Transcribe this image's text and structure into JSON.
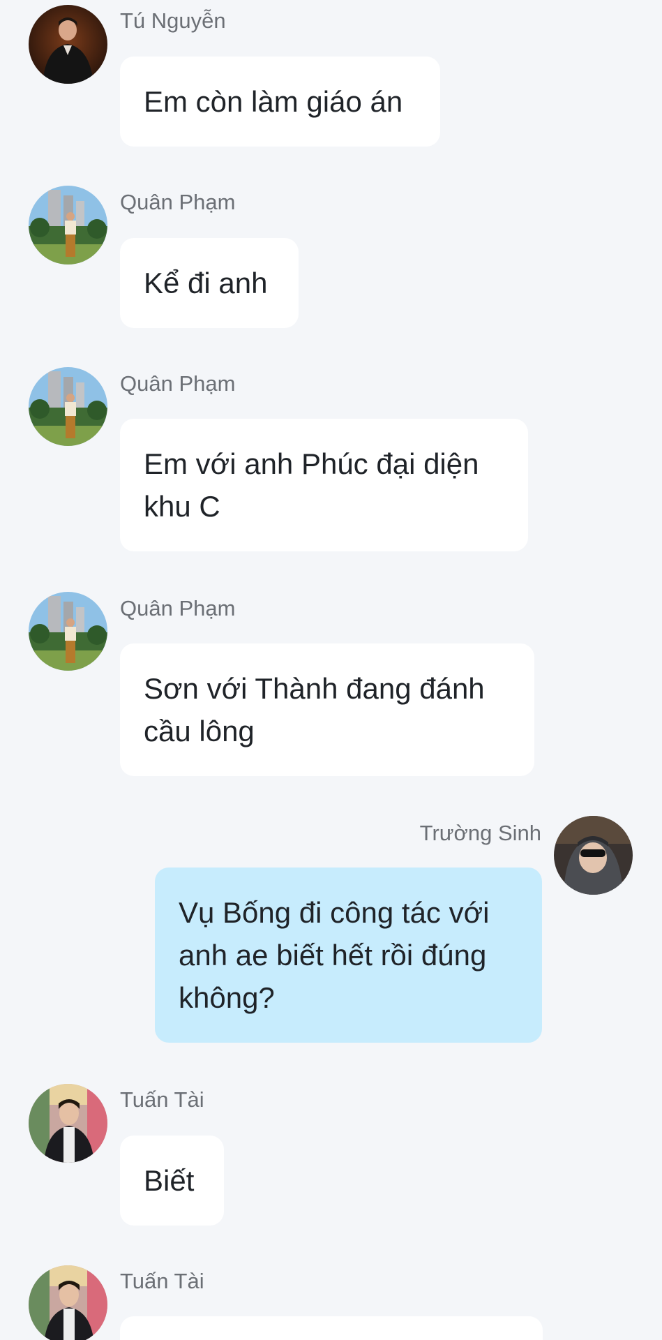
{
  "colors": {
    "background": "#f4f6f9",
    "incoming_bubble": "#ffffff",
    "outgoing_bubble": "#c7ecfd",
    "sender_text": "#6b6f75",
    "message_text": "#1f2328"
  },
  "messages": [
    {
      "sender": "Tú Nguyễn",
      "text": "Em còn làm giáo án",
      "direction": "incoming",
      "avatar": "tu-nguyen-avatar"
    },
    {
      "sender": "Quân Phạm",
      "text": "Kể đi anh",
      "direction": "incoming",
      "avatar": "quan-pham-avatar"
    },
    {
      "sender": "Quân Phạm",
      "text": "Em với anh Phúc đại diện\nkhu C",
      "direction": "incoming",
      "avatar": "quan-pham-avatar"
    },
    {
      "sender": "Quân Phạm",
      "text": "Sơn với Thành đang đánh\ncầu lông",
      "direction": "incoming",
      "avatar": "quan-pham-avatar"
    },
    {
      "sender": "Trường Sinh",
      "text": "Vụ Bống đi công tác với\nanh ae biết hết rồi đúng\nkhông?",
      "direction": "outgoing",
      "avatar": "truong-sinh-avatar"
    },
    {
      "sender": "Tuấn Tài",
      "text": "Biết",
      "direction": "incoming",
      "avatar": "tuan-tai-avatar"
    },
    {
      "sender": "Tuấn Tài",
      "text": "",
      "direction": "incoming",
      "avatar": "tuan-tai-avatar"
    }
  ]
}
